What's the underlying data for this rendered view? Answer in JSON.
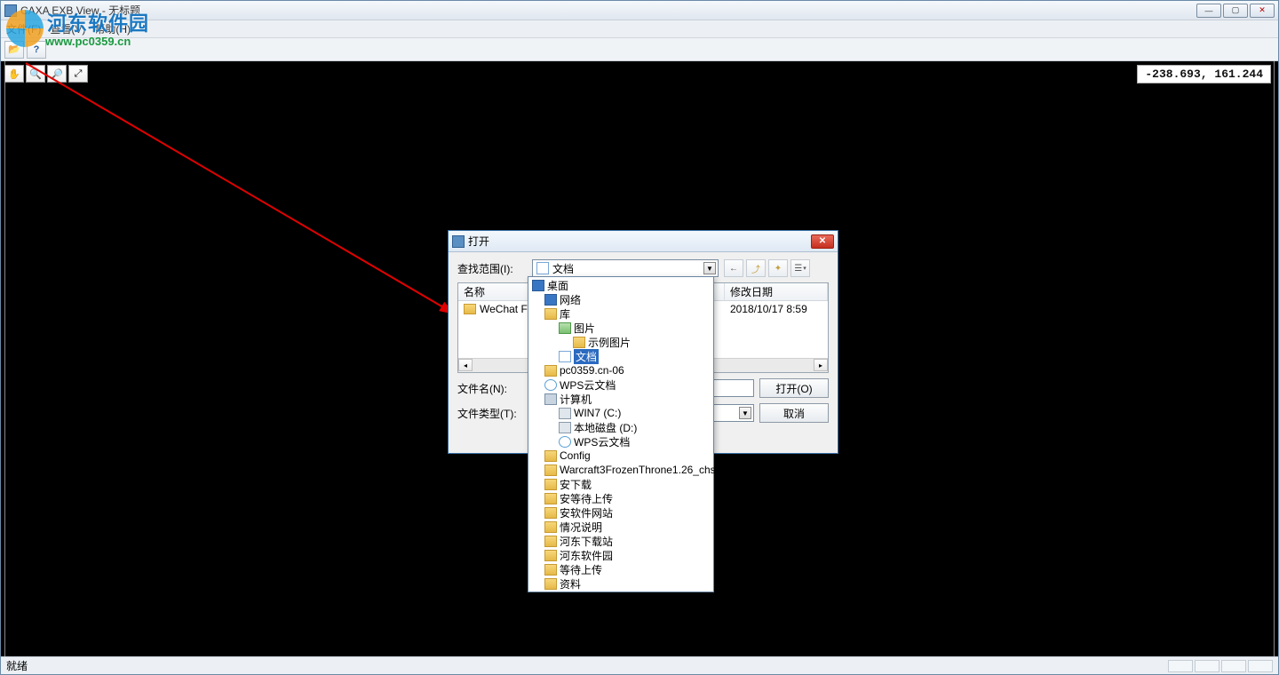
{
  "window": {
    "title": "CAXA EXB View - 无标题",
    "min": "—",
    "max": "▢",
    "close": "✕"
  },
  "menus": {
    "file": "文件(F)",
    "view": "查看(V)",
    "help": "帮助(H)"
  },
  "watermark": {
    "title": "河东软件园",
    "url": "www.pc0359.cn"
  },
  "coords": "-238.693, 161.244",
  "statusbar": {
    "ready": "就绪"
  },
  "dialog": {
    "title": "打开",
    "lookin_label": "查找范围(I):",
    "lookin_value": "文档",
    "nav": {
      "back": "←",
      "up": "⤴",
      "newfolder": "✦",
      "views": "☰",
      "views_drop": "▾"
    },
    "columns": {
      "name": "名称",
      "date": "修改日期"
    },
    "rows": [
      {
        "name": "WeChat Files",
        "date": "2018/10/17 8:59"
      }
    ],
    "filename_label": "文件名(N):",
    "filename_value": "",
    "filetype_label": "文件类型(T):",
    "filetype_value": "",
    "open_btn": "打开(O)",
    "cancel_btn": "取消"
  },
  "tree": [
    {
      "label": "桌面",
      "icon": "ico-desktop",
      "indent": 0
    },
    {
      "label": "网络",
      "icon": "ico-network",
      "indent": 1
    },
    {
      "label": "库",
      "icon": "ico-library",
      "indent": 1
    },
    {
      "label": "图片",
      "icon": "ico-pics",
      "indent": 2
    },
    {
      "label": "示例图片",
      "icon": "ico-folder",
      "indent": 3
    },
    {
      "label": "文档",
      "icon": "ico-doc",
      "indent": 2,
      "selected": true
    },
    {
      "label": "pc0359.cn-06",
      "icon": "ico-folder",
      "indent": 1
    },
    {
      "label": "WPS云文档",
      "icon": "ico-cloud",
      "indent": 1
    },
    {
      "label": "计算机",
      "icon": "ico-computer",
      "indent": 1
    },
    {
      "label": "WIN7 (C:)",
      "icon": "ico-drive",
      "indent": 2
    },
    {
      "label": "本地磁盘 (D:)",
      "icon": "ico-drive",
      "indent": 2
    },
    {
      "label": "WPS云文档",
      "icon": "ico-cloud",
      "indent": 2
    },
    {
      "label": "Config",
      "icon": "ico-folder",
      "indent": 1
    },
    {
      "label": "Warcraft3FrozenThrone1.26_chs",
      "icon": "ico-folder",
      "indent": 1
    },
    {
      "label": "安下载",
      "icon": "ico-folder",
      "indent": 1
    },
    {
      "label": "安等待上传",
      "icon": "ico-folder",
      "indent": 1
    },
    {
      "label": "安软件网站",
      "icon": "ico-folder",
      "indent": 1
    },
    {
      "label": "情况说明",
      "icon": "ico-folder",
      "indent": 1
    },
    {
      "label": "河东下载站",
      "icon": "ico-folder",
      "indent": 1
    },
    {
      "label": "河东软件园",
      "icon": "ico-folder",
      "indent": 1
    },
    {
      "label": "等待上传",
      "icon": "ico-folder",
      "indent": 1
    },
    {
      "label": "资料",
      "icon": "ico-folder",
      "indent": 1
    }
  ]
}
